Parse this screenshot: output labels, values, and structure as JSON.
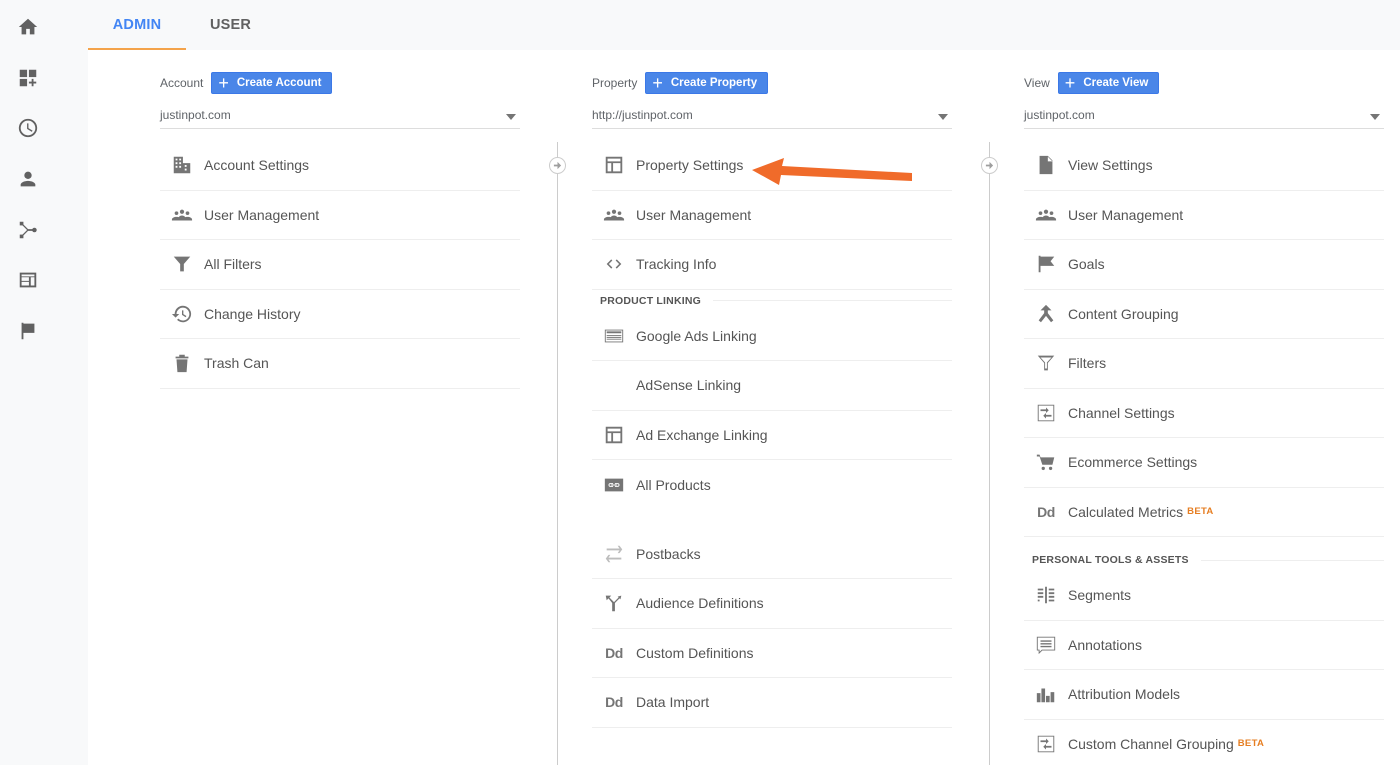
{
  "rail": {
    "items": [
      {
        "name": "home-icon",
        "label": "Home"
      },
      {
        "name": "customization-icon",
        "label": "Customization"
      },
      {
        "name": "realtime-icon",
        "label": "Realtime"
      },
      {
        "name": "audience-icon",
        "label": "Audience"
      },
      {
        "name": "acquisition-icon",
        "label": "Acquisition"
      },
      {
        "name": "behavior-icon",
        "label": "Behavior"
      },
      {
        "name": "conversions-icon",
        "label": "Conversions"
      }
    ]
  },
  "tabs": [
    {
      "label": "ADMIN",
      "active": true
    },
    {
      "label": "USER",
      "active": false
    }
  ],
  "columns": {
    "account": {
      "label": "Account",
      "create_label": "Create Account",
      "selected": "justinpot.com",
      "items": [
        {
          "icon": "building-icon",
          "label": "Account Settings"
        },
        {
          "icon": "people-icon",
          "label": "User Management"
        },
        {
          "icon": "filter-icon",
          "label": "All Filters"
        },
        {
          "icon": "history-icon",
          "label": "Change History"
        },
        {
          "icon": "trash-icon",
          "label": "Trash Can"
        }
      ]
    },
    "property": {
      "label": "Property",
      "create_label": "Create Property",
      "selected": "http://justinpot.com",
      "items": [
        {
          "icon": "layout-icon",
          "label": "Property Settings"
        },
        {
          "icon": "people-icon",
          "label": "User Management"
        },
        {
          "icon": "code-icon",
          "label": "Tracking Info"
        }
      ],
      "section_title": "PRODUCT LINKING",
      "linking_items": [
        {
          "icon": "ads-icon",
          "label": "Google Ads Linking"
        },
        {
          "icon": "none",
          "label": "AdSense Linking"
        },
        {
          "icon": "layout-icon",
          "label": "Ad Exchange Linking"
        },
        {
          "icon": "link-icon",
          "label": "All Products"
        }
      ],
      "more_items": [
        {
          "icon": "postbacks-icon",
          "label": "Postbacks"
        },
        {
          "icon": "fork-icon",
          "label": "Audience Definitions"
        },
        {
          "icon": "dd-icon",
          "label": "Custom Definitions"
        },
        {
          "icon": "dd-icon",
          "label": "Data Import"
        }
      ]
    },
    "view": {
      "label": "View",
      "create_label": "Create View",
      "selected": "justinpot.com",
      "items": [
        {
          "icon": "document-icon",
          "label": "View Settings"
        },
        {
          "icon": "people-icon",
          "label": "User Management"
        },
        {
          "icon": "flag-icon",
          "label": "Goals"
        },
        {
          "icon": "merge-icon",
          "label": "Content Grouping"
        },
        {
          "icon": "filter-icon",
          "label": "Filters"
        },
        {
          "icon": "channel-icon",
          "label": "Channel Settings"
        },
        {
          "icon": "cart-icon",
          "label": "Ecommerce Settings"
        },
        {
          "icon": "dd-icon",
          "label": "Calculated Metrics",
          "badge": "BETA"
        }
      ],
      "section_title": "PERSONAL TOOLS & ASSETS",
      "personal_items": [
        {
          "icon": "segments-icon",
          "label": "Segments"
        },
        {
          "icon": "comment-icon",
          "label": "Annotations"
        },
        {
          "icon": "bars-icon",
          "label": "Attribution Models"
        },
        {
          "icon": "channel-icon",
          "label": "Custom Channel Grouping",
          "badge": "BETA"
        }
      ]
    }
  },
  "colors": {
    "accent": "#4285f4",
    "button": "#4a86e8",
    "tab_underline": "#f4a34a",
    "beta": "#e67e22",
    "annotation_arrow": "#f06b2a"
  },
  "dd_glyph": "Dd"
}
